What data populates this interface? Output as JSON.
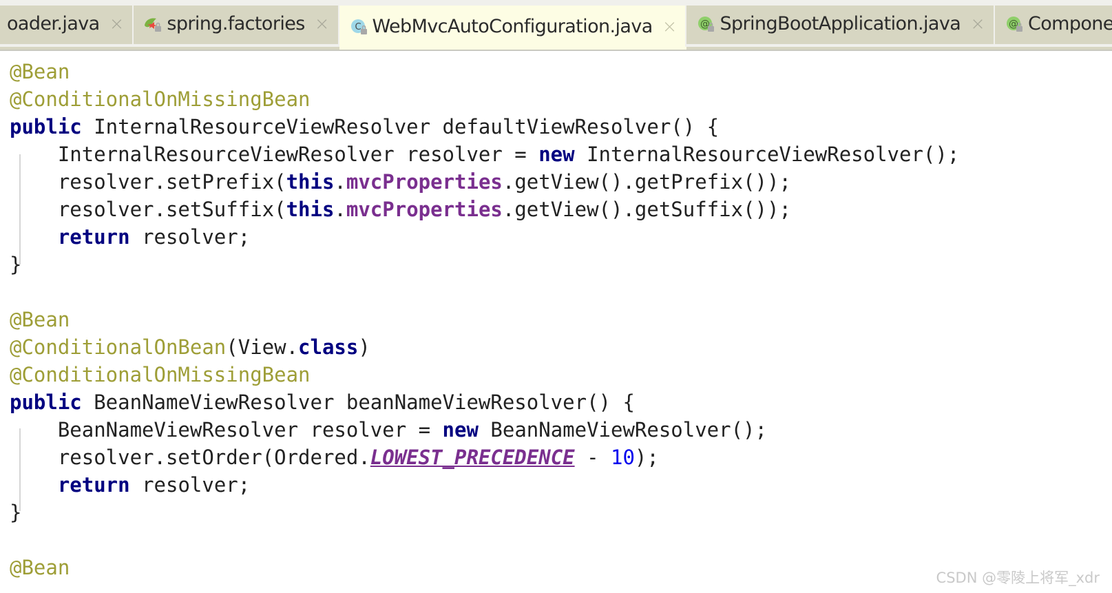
{
  "window": {
    "title": "WebMvcAutoConfiguration.java",
    "bg_color": "#ffffff",
    "tabbar_bg": "#f0f0ec",
    "tab_inactive_color": "#d7d6c2",
    "tab_active_color": "#fdfde4"
  },
  "tabs": [
    {
      "label": "oader.java",
      "icon": "none-icon",
      "icon_type": "none",
      "active": false,
      "truncated_left": true,
      "close_label": "×"
    },
    {
      "label": "spring.factories",
      "icon": "spring-leaf-icon",
      "icon_type": "spring",
      "active": false,
      "close_label": "×"
    },
    {
      "label": "WebMvcAutoConfiguration.java",
      "icon": "java-class-icon",
      "icon_type": "class",
      "active": true,
      "close_label": "×"
    },
    {
      "label": "SpringBootApplication.java",
      "icon": "java-annotation-icon",
      "icon_type": "annotation",
      "active": false,
      "close_label": "×"
    },
    {
      "label": "ComponentS",
      "icon": "java-annotation-icon",
      "icon_type": "annotation",
      "active": false,
      "truncated_right": true,
      "close_label": ""
    }
  ],
  "editor": {
    "language": "java",
    "font_size_px": 29,
    "line_height_px": 40,
    "colors": {
      "annotation": "#9e9e37",
      "keyword": "#000080",
      "field": "#7a2f8f",
      "static_final": "#7a2f8f",
      "number": "#0000ee",
      "plain": "#222222",
      "indent_guide": "#d6d6d6"
    },
    "code_lines": [
      {
        "id": "l1",
        "tokens": [
          {
            "t": "@Bean",
            "c": "ann"
          }
        ]
      },
      {
        "id": "l2",
        "tokens": [
          {
            "t": "@ConditionalOnMissingBean",
            "c": "ann"
          }
        ]
      },
      {
        "id": "l3",
        "tokens": [
          {
            "t": "public",
            "c": "kw"
          },
          {
            "t": " InternalResourceViewResolver defaultViewResolver() {",
            "c": "plain"
          }
        ]
      },
      {
        "id": "l4",
        "tokens": [
          {
            "t": "    InternalResourceViewResolver resolver = ",
            "c": "plain"
          },
          {
            "t": "new",
            "c": "kw"
          },
          {
            "t": " InternalResourceViewResolver();",
            "c": "plain"
          }
        ]
      },
      {
        "id": "l5",
        "tokens": [
          {
            "t": "    resolver.setPrefix(",
            "c": "plain"
          },
          {
            "t": "this",
            "c": "kw"
          },
          {
            "t": ".",
            "c": "plain"
          },
          {
            "t": "mvcProperties",
            "c": "field"
          },
          {
            "t": ".getView().getPrefix());",
            "c": "plain"
          }
        ]
      },
      {
        "id": "l6",
        "tokens": [
          {
            "t": "    resolver.setSuffix(",
            "c": "plain"
          },
          {
            "t": "this",
            "c": "kw"
          },
          {
            "t": ".",
            "c": "plain"
          },
          {
            "t": "mvcProperties",
            "c": "field"
          },
          {
            "t": ".getView().getSuffix());",
            "c": "plain"
          }
        ]
      },
      {
        "id": "l7",
        "tokens": [
          {
            "t": "    ",
            "c": "plain"
          },
          {
            "t": "return",
            "c": "kw"
          },
          {
            "t": " resolver;",
            "c": "plain"
          }
        ]
      },
      {
        "id": "l8",
        "tokens": [
          {
            "t": "}",
            "c": "plain"
          }
        ]
      },
      {
        "id": "l9",
        "tokens": [
          {
            "t": "",
            "c": "plain"
          }
        ]
      },
      {
        "id": "l10",
        "tokens": [
          {
            "t": "@Bean",
            "c": "ann"
          }
        ]
      },
      {
        "id": "l11",
        "tokens": [
          {
            "t": "@ConditionalOnBean",
            "c": "ann"
          },
          {
            "t": "(View.",
            "c": "plain"
          },
          {
            "t": "class",
            "c": "kw"
          },
          {
            "t": ")",
            "c": "plain"
          }
        ]
      },
      {
        "id": "l12",
        "tokens": [
          {
            "t": "@ConditionalOnMissingBean",
            "c": "ann"
          }
        ]
      },
      {
        "id": "l13",
        "tokens": [
          {
            "t": "public",
            "c": "kw"
          },
          {
            "t": " BeanNameViewResolver beanNameViewResolver() {",
            "c": "plain"
          }
        ]
      },
      {
        "id": "l14",
        "tokens": [
          {
            "t": "    BeanNameViewResolver resolver = ",
            "c": "plain"
          },
          {
            "t": "new",
            "c": "kw"
          },
          {
            "t": " BeanNameViewResolver();",
            "c": "plain"
          }
        ]
      },
      {
        "id": "l15",
        "tokens": [
          {
            "t": "    resolver.setOrder(Ordered.",
            "c": "plain"
          },
          {
            "t": "LOWEST_PRECEDENCE",
            "c": "static"
          },
          {
            "t": " - ",
            "c": "plain"
          },
          {
            "t": "10",
            "c": "num"
          },
          {
            "t": ");",
            "c": "plain"
          }
        ]
      },
      {
        "id": "l16",
        "tokens": [
          {
            "t": "    ",
            "c": "plain"
          },
          {
            "t": "return",
            "c": "kw"
          },
          {
            "t": " resolver;",
            "c": "plain"
          }
        ]
      },
      {
        "id": "l17",
        "tokens": [
          {
            "t": "}",
            "c": "plain"
          }
        ]
      },
      {
        "id": "l18",
        "tokens": [
          {
            "t": "",
            "c": "plain"
          }
        ]
      },
      {
        "id": "l19",
        "tokens": [
          {
            "t": "@Bean",
            "c": "ann"
          }
        ]
      }
    ]
  },
  "watermark": {
    "text": "CSDN @零陵上将军_xdr"
  }
}
